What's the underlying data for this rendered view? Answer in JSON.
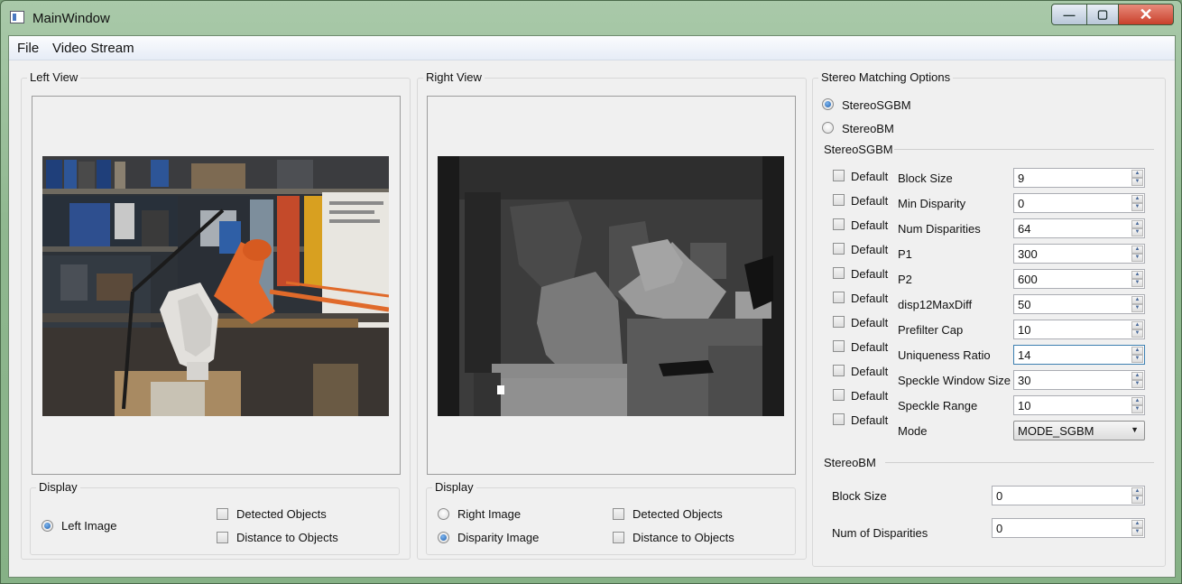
{
  "window": {
    "title": "MainWindow",
    "minimize_glyph": "—",
    "maximize_glyph": "▢",
    "close_glyph": "✕"
  },
  "menu": [
    "File",
    "Video Stream"
  ],
  "left_view": {
    "title": "Left View",
    "display": {
      "title": "Display",
      "radio_left_image": "Left Image",
      "check_detected": "Detected Objects",
      "check_distance": "Distance to Objects"
    }
  },
  "right_view": {
    "title": "Right View",
    "display": {
      "title": "Display",
      "radio_right_image": "Right Image",
      "radio_disparity_image": "Disparity Image",
      "check_detected": "Detected Objects",
      "check_distance": "Distance to Objects"
    }
  },
  "options": {
    "title": "Stereo Matching Options",
    "radio_sgbm": "StereoSGBM",
    "radio_bm": "StereoBM",
    "sgbm": {
      "title": "StereoSGBM",
      "default_label": "Default",
      "rows": [
        {
          "label": "Block Size",
          "value": "9"
        },
        {
          "label": "Min Disparity",
          "value": "0"
        },
        {
          "label": "Num Disparities",
          "value": "64"
        },
        {
          "label": "P1",
          "value": "300"
        },
        {
          "label": "P2",
          "value": "600"
        },
        {
          "label": "disp12MaxDiff",
          "value": "50"
        },
        {
          "label": "Prefilter Cap",
          "value": "10"
        },
        {
          "label": "Uniqueness Ratio",
          "value": "14"
        },
        {
          "label": "Speckle Window Size",
          "value": "30"
        },
        {
          "label": "Speckle Range",
          "value": "10"
        }
      ],
      "mode_label": "Mode",
      "mode_value": "MODE_SGBM"
    },
    "bm": {
      "title": "StereoBM",
      "rows": [
        {
          "label": "Block Size",
          "value": "0"
        },
        {
          "label": "Num of Disparities",
          "value": "0"
        }
      ]
    }
  }
}
